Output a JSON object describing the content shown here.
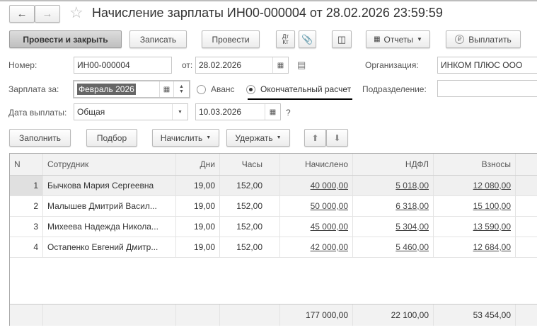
{
  "title": "Начисление зарплаты ИН00-000004 от 28.02.2026 23:59:59",
  "toolbar": {
    "post_close": "Провести и закрыть",
    "save": "Записать",
    "post": "Провести",
    "dtkt_top": "Дт",
    "dtkt_bottom": "Кт",
    "reports": "Отчеты",
    "pay": "Выплатить"
  },
  "form": {
    "number_label": "Номер:",
    "number": "ИН00-000004",
    "date_label": "от:",
    "date": "28.02.2026",
    "org_label": "Организация:",
    "org": "ИНКОМ ПЛЮС ООО",
    "salary_for_label": "Зарплата за:",
    "salary_for": "Февраль 2026",
    "radio_advance": "Аванс",
    "radio_final": "Окончательный расчет",
    "radio_selected": "Окончательный расчет",
    "dept_label": "Подразделение:",
    "dept": "",
    "pay_date_label": "Дата выплаты:",
    "pay_date_type": "Общая",
    "pay_date": "10.03.2026",
    "help": "?"
  },
  "table_toolbar": {
    "fill": "Заполнить",
    "pick": "Подбор",
    "accrue": "Начислить",
    "withhold": "Удержать"
  },
  "table": {
    "columns": [
      "N",
      "Сотрудник",
      "Дни",
      "Часы",
      "Начислено",
      "НДФЛ",
      "Взносы"
    ],
    "rows": [
      [
        "1",
        "Бычкова Мария Сергеевна",
        "19,00",
        "152,00",
        "40 000,00",
        "5 018,00",
        "12 080,00"
      ],
      [
        "2",
        "Малышев Дмитрий Васил...",
        "19,00",
        "152,00",
        "50 000,00",
        "6 318,00",
        "15 100,00"
      ],
      [
        "3",
        "Михеева Надежда Никола...",
        "19,00",
        "152,00",
        "45 000,00",
        "5 304,00",
        "13 590,00"
      ],
      [
        "4",
        "Остапенко Евгений Дмитр...",
        "19,00",
        "152,00",
        "42 000,00",
        "5 460,00",
        "12 684,00"
      ]
    ],
    "totals": {
      "accrued": "177 000,00",
      "ndfl": "22 100,00",
      "contrib": "53 454,00"
    }
  }
}
